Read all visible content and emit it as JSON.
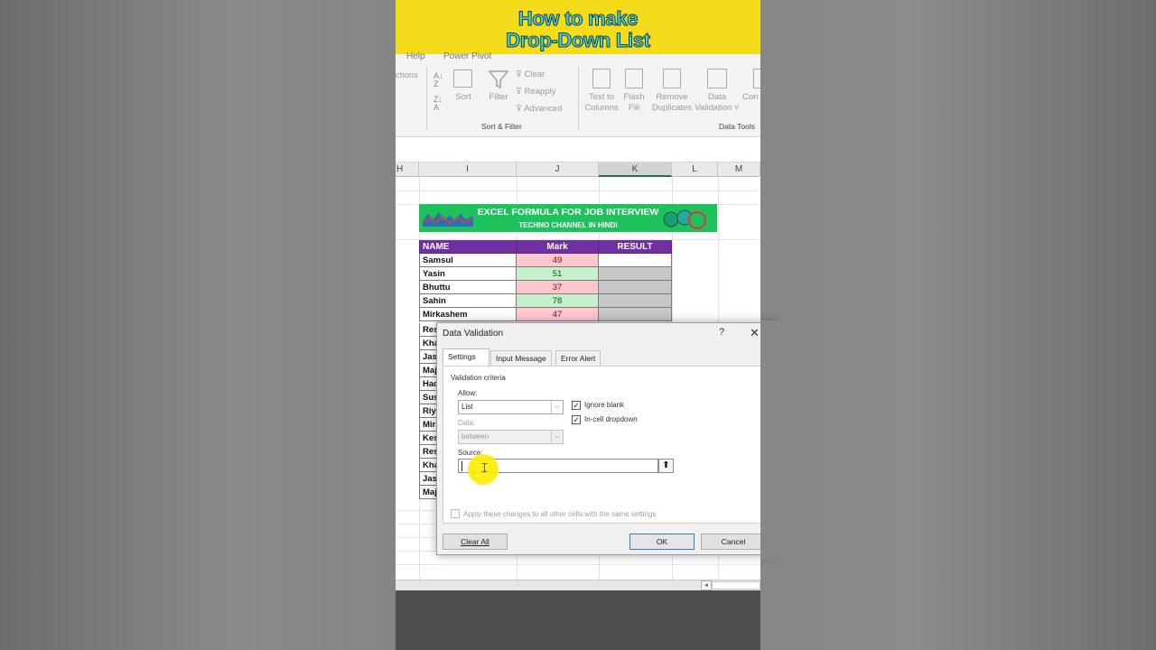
{
  "banner": {
    "line1": "How to make",
    "line2": "Drop-Down List"
  },
  "ribbon": {
    "tabs": [
      "Help",
      "Power Pivot"
    ],
    "left_cut_label": "ctions",
    "sort_label": "Sort",
    "filter_label": "Filter",
    "clear_label": "Clear",
    "reapply_label": "Reapply",
    "advanced_label": "Advanced",
    "text_to_columns_label1": "Text to",
    "text_to_columns_label2": "Columns",
    "flash_fill_label1": "Flash",
    "flash_fill_label2": "Fill",
    "remove_dup_label1": "Remove",
    "remove_dup_label2": "Duplicates",
    "data_validation_label1": "Data",
    "data_validation_label2": "Validation ˅",
    "consolidate_cut_label": "Con",
    "group_sort_filter": "Sort & Filter",
    "group_data_tools": "Data Tools"
  },
  "columns": [
    "H",
    "I",
    "J",
    "K",
    "L",
    "M"
  ],
  "sheet_banner": {
    "title": "EXCEL FORMULA FOR JOB INTERVIEW",
    "subtitle": "TECHNO CHANNEL IN HINDI"
  },
  "table": {
    "headers": [
      "NAME",
      "Mark",
      "RESULT"
    ],
    "rows": [
      {
        "name": "Samsul",
        "mark": "49",
        "tone": "red",
        "result_tone": "wht"
      },
      {
        "name": "Yasin",
        "mark": "51",
        "tone": "grn",
        "result_tone": "grey"
      },
      {
        "name": "Bhuttu",
        "mark": "37",
        "tone": "red",
        "result_tone": "grey"
      },
      {
        "name": "Sahin",
        "mark": "78",
        "tone": "grn",
        "result_tone": "grey"
      },
      {
        "name": "Mirkashem",
        "mark": "47",
        "tone": "red",
        "result_tone": "grey"
      }
    ],
    "hidden_names": [
      "Res",
      "Kha",
      "Jasr",
      "Maj",
      "Had",
      "Susr",
      "Riya",
      "Mirk",
      "Kesl",
      "Res",
      "Kha",
      "Jasr",
      "Maj"
    ]
  },
  "dialog": {
    "title": "Data Validation",
    "help": "?",
    "close": "✕",
    "tabs": [
      "Settings",
      "Input Message",
      "Error Alert"
    ],
    "criteria_label": "Validation criteria",
    "allow_label": "Allow:",
    "allow_value": "List",
    "data_label": "Data:",
    "data_value": "between",
    "ignore_blank": "Ignore blank",
    "in_cell_dropdown": "In-cell dropdown",
    "source_label": "Source:",
    "source_value": "",
    "apply_all": "Apply these changes to all other cells with the same settings",
    "clear_all": "Clear All",
    "ok": "OK",
    "cancel": "Cancel"
  },
  "colors": {
    "banner_bg": "#f5dc1a",
    "banner_text": "#4fd3df",
    "header_purple": "#7030a0",
    "sheet_green": "#1ec25d"
  }
}
